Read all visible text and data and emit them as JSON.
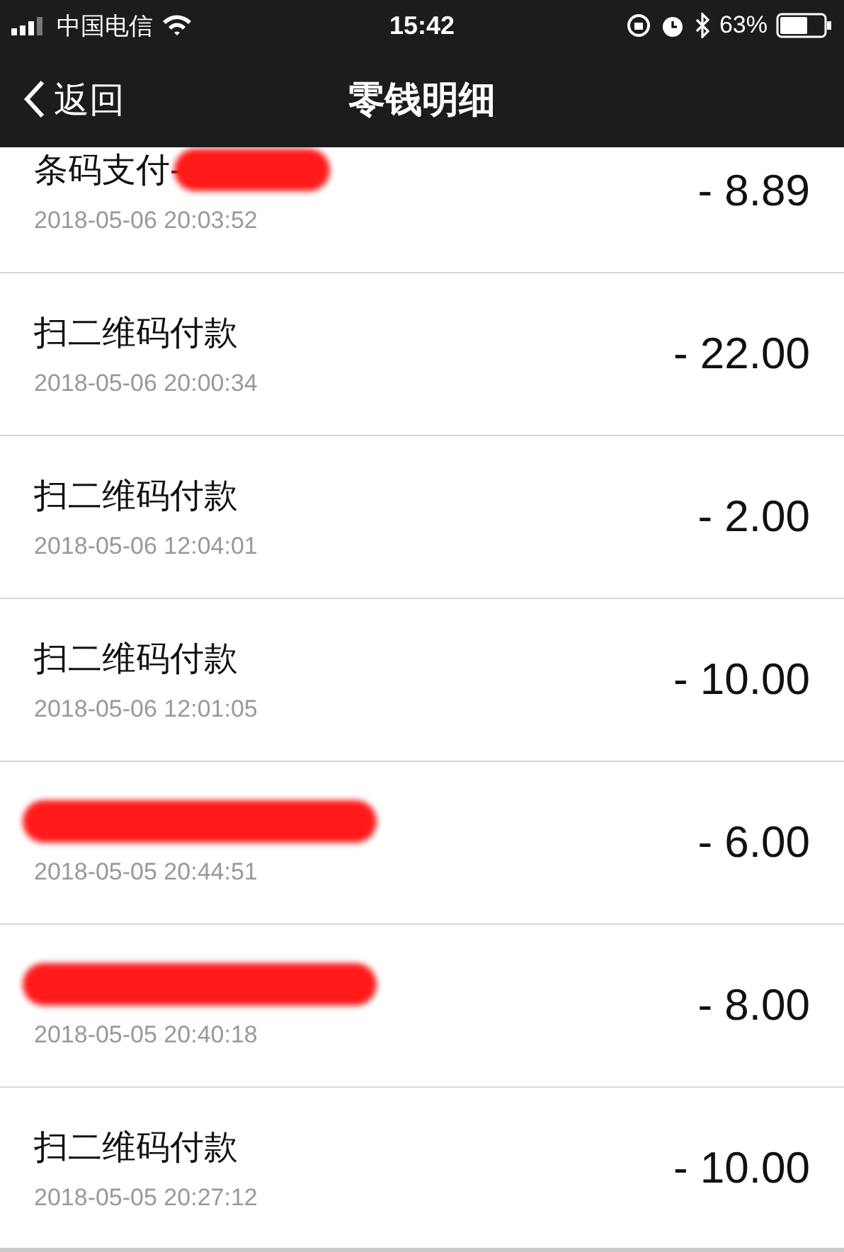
{
  "status_bar": {
    "carrier": "中国电信",
    "time": "15:42",
    "battery": "63%"
  },
  "nav": {
    "back": "返回",
    "title": "零钱明细"
  },
  "rows": [
    {
      "title": "条码支付-",
      "redacted": true,
      "date": "2018-05-06 20:03:52",
      "amount": "- 8.89"
    },
    {
      "title": "扫二维码付款",
      "redacted": false,
      "date": "2018-05-06 20:00:34",
      "amount": "- 22.00"
    },
    {
      "title": "扫二维码付款",
      "redacted": false,
      "date": "2018-05-06 12:04:01",
      "amount": "- 2.00"
    },
    {
      "title": "扫二维码付款",
      "redacted": false,
      "date": "2018-05-06 12:01:05",
      "amount": "- 10.00"
    },
    {
      "redacted": true,
      "date": "2018-05-05 20:44:51",
      "amount": "- 6.00"
    },
    {
      "redacted": true,
      "date": "2018-05-05 20:40:18",
      "amount": "- 8.00"
    },
    {
      "title": "扫二维码付款",
      "redacted": false,
      "date": "2018-05-05 20:27:12",
      "amount": "- 10.00"
    }
  ]
}
